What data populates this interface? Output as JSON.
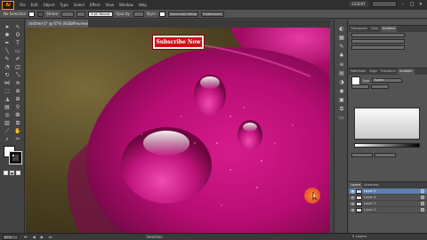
{
  "menubar": {
    "logo": "Ai",
    "items": [
      "File",
      "Edit",
      "Object",
      "Type",
      "Select",
      "Effect",
      "View",
      "Window",
      "Help"
    ],
    "workspace": "ESSENT",
    "window_controls": [
      "–",
      "□",
      "✕"
    ]
  },
  "controlbar": {
    "selection": "No Selection",
    "stroke_label": "Stroke:",
    "brush_label": "5 pt. Round",
    "opacity_label": "Opacity:",
    "style_label": "Style:",
    "document_setup": "Document Setup",
    "preferences": "Preferences"
  },
  "document": {
    "tab_title": "Untitled-1* @ 67% (RGB/Preview)"
  },
  "canvas": {
    "button_label": "Subscribe Now",
    "colors": {
      "petal": "#c2127a",
      "petal_dark": "#7a0a4a",
      "background": "#5c4b2a",
      "cursor": "#ff6a2a"
    }
  },
  "panels": {
    "top_tabs": [
      "Transparen",
      "Color",
      "Gradient"
    ],
    "mid_tabs": [
      "Pathfinder",
      "Align",
      "Transform",
      "Gradient"
    ],
    "layers_tabs": [
      "Layers",
      "Artboards"
    ],
    "gradient_type": "Type:",
    "gradient_type_value": "Radial",
    "layers": [
      {
        "name": "Layer 5",
        "selected": true
      },
      {
        "name": "Layer 4",
        "selected": false
      },
      {
        "name": "Layer 3",
        "selected": false
      },
      {
        "name": "Layer 2",
        "selected": false
      }
    ],
    "layers_count": "5 Layers"
  },
  "statusbar": {
    "zoom": "67%",
    "tool": "Selection"
  }
}
